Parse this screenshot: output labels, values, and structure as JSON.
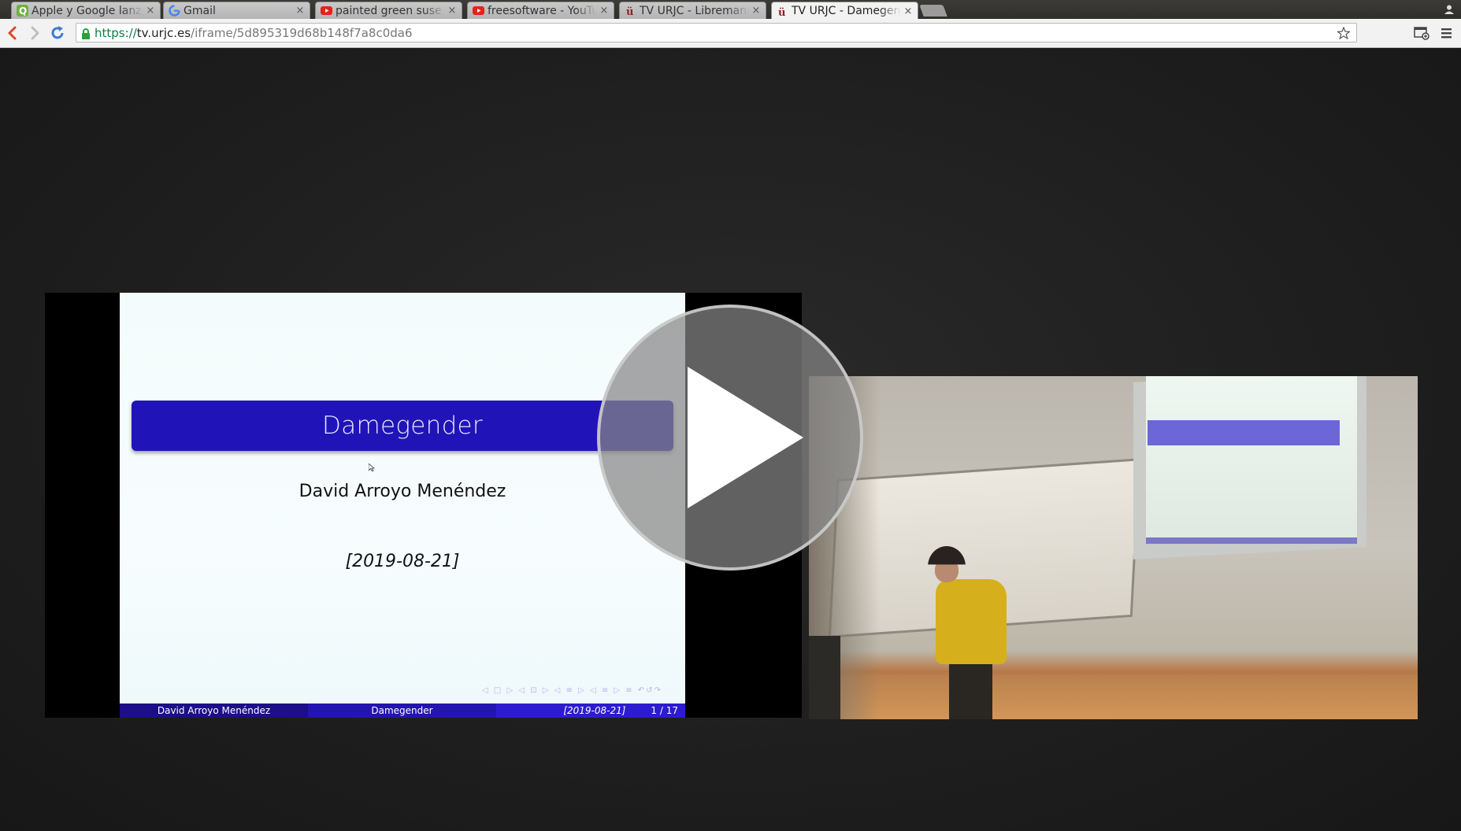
{
  "browser": {
    "tabs": [
      {
        "title": "Apple y Google lanz",
        "icon": "green-q-favicon",
        "active": false
      },
      {
        "title": "Gmail",
        "icon": "google-g-favicon",
        "active": false
      },
      {
        "title": "painted green suse",
        "icon": "youtube-favicon",
        "active": false
      },
      {
        "title": "freesoftware - YouTu",
        "icon": "youtube-favicon",
        "active": false
      },
      {
        "title": "TV URJC - Libremani",
        "icon": "urjc-favicon",
        "active": false
      },
      {
        "title": "TV URJC - Damegend",
        "icon": "urjc-favicon",
        "active": true
      }
    ],
    "tab_close_label": "×",
    "address": {
      "scheme": "https://",
      "host": "tv.urjc.es",
      "path": "/iframe/5d895319d68b148f7a8c0da6"
    }
  },
  "slide": {
    "title": "Damegender",
    "author": "David Arroyo Menéndez",
    "date": "[2019-08-21]",
    "nav_symbols": "◁ □ ▷ ◁ ⊡ ▷ ◁ ≡ ▷ ◁ ≡ ▷ ≡ ↶↺↷",
    "footer": {
      "author": "David Arroyo Menéndez",
      "title": "Damegender",
      "date": "[2019-08-21]",
      "page": "1 / 17"
    }
  },
  "colors": {
    "slide_title_bar": "#2014b8",
    "footer_dark": "#1c0f87",
    "footer_mid": "#2414b0",
    "footer_light": "#2d1ccf",
    "speaker_shirt": "#d6b01c",
    "page_background": "#1f1f1f"
  }
}
